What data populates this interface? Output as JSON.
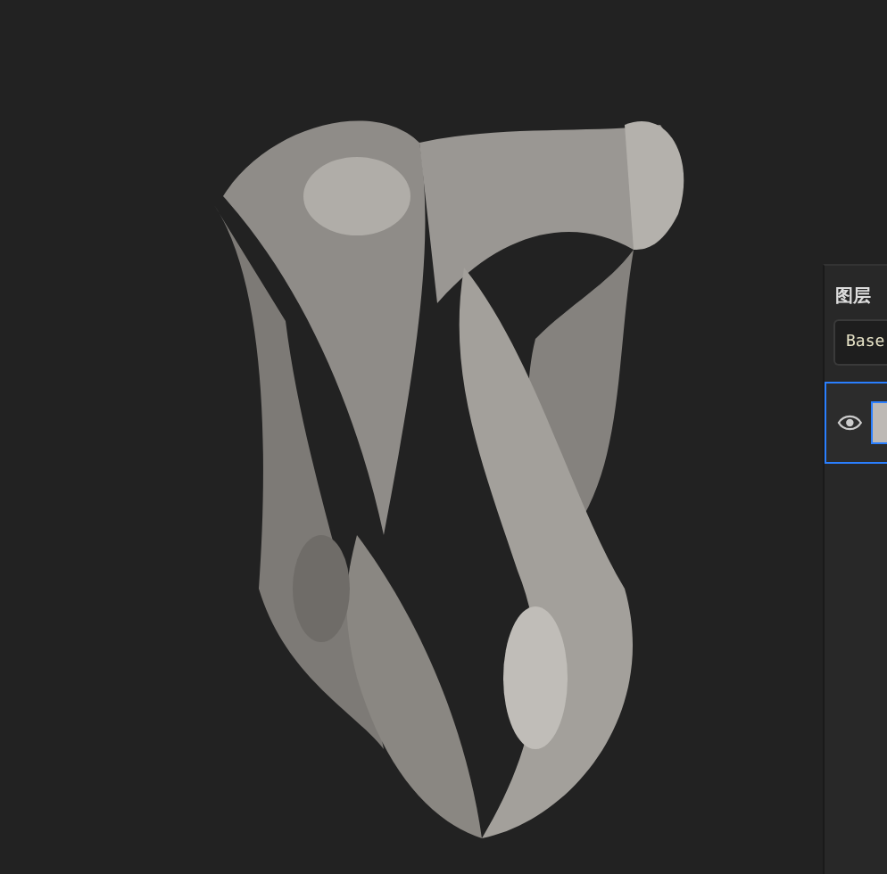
{
  "layers_panel": {
    "title": "图层",
    "blend_mode": "Base",
    "layers": [
      {
        "selected": true,
        "visible": true
      }
    ]
  }
}
